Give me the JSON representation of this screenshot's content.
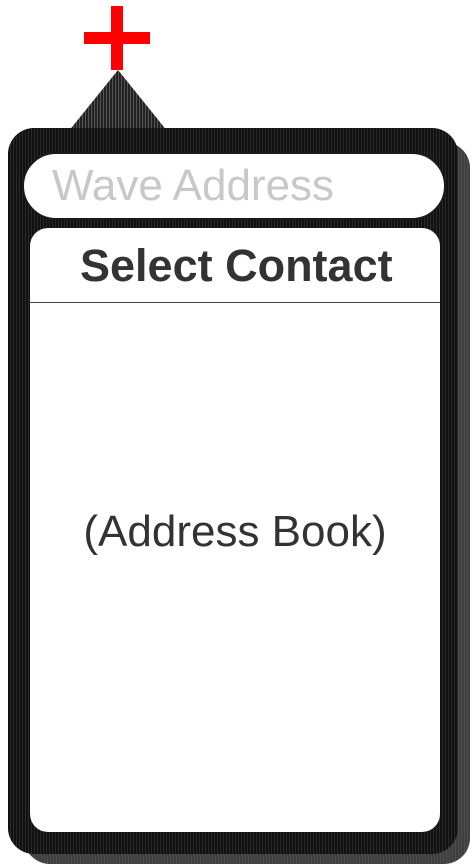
{
  "add_button": {
    "icon": "plus-icon",
    "color": "#ff0000"
  },
  "search": {
    "placeholder": "Wave Address",
    "value": ""
  },
  "contact_panel": {
    "title": "Select Contact",
    "body_label": "(Address Book)"
  },
  "colors": {
    "accent": "#ff0000",
    "panel": "#1a1a1a",
    "text": "#333333",
    "placeholder": "#c8c8c8"
  }
}
